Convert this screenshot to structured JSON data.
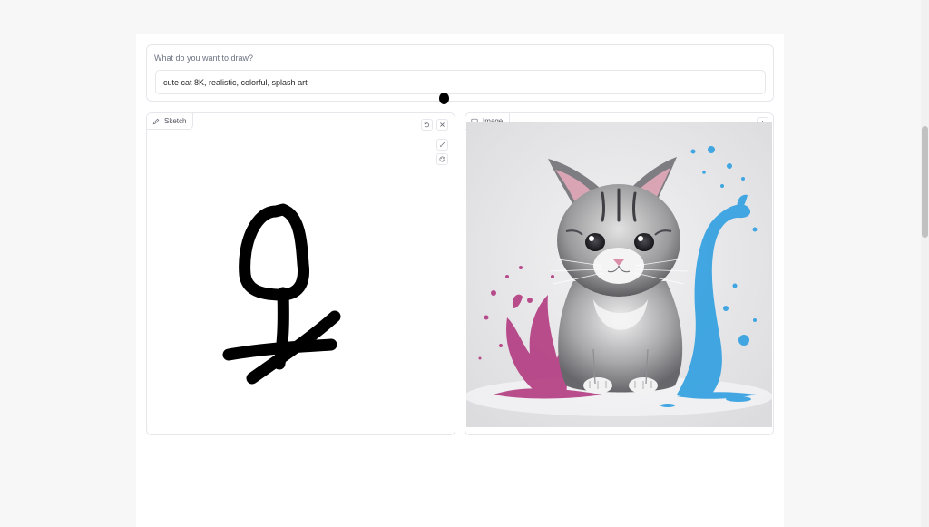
{
  "prompt": {
    "label": "What do you want to draw?",
    "value": "cute cat 8K, realistic, colorful, splash art"
  },
  "sketch": {
    "label": "Sketch",
    "icons": [
      "pencil-icon",
      "undo-icon",
      "close-icon",
      "brush-icon",
      "palette-icon"
    ]
  },
  "output": {
    "label": "Image",
    "icons": [
      "image-icon",
      "download-icon"
    ]
  },
  "colors": {
    "border": "#e5e7eb",
    "stroke": "#000000",
    "splash_pink": "#b0307a",
    "splash_blue": "#2f9fe0"
  }
}
